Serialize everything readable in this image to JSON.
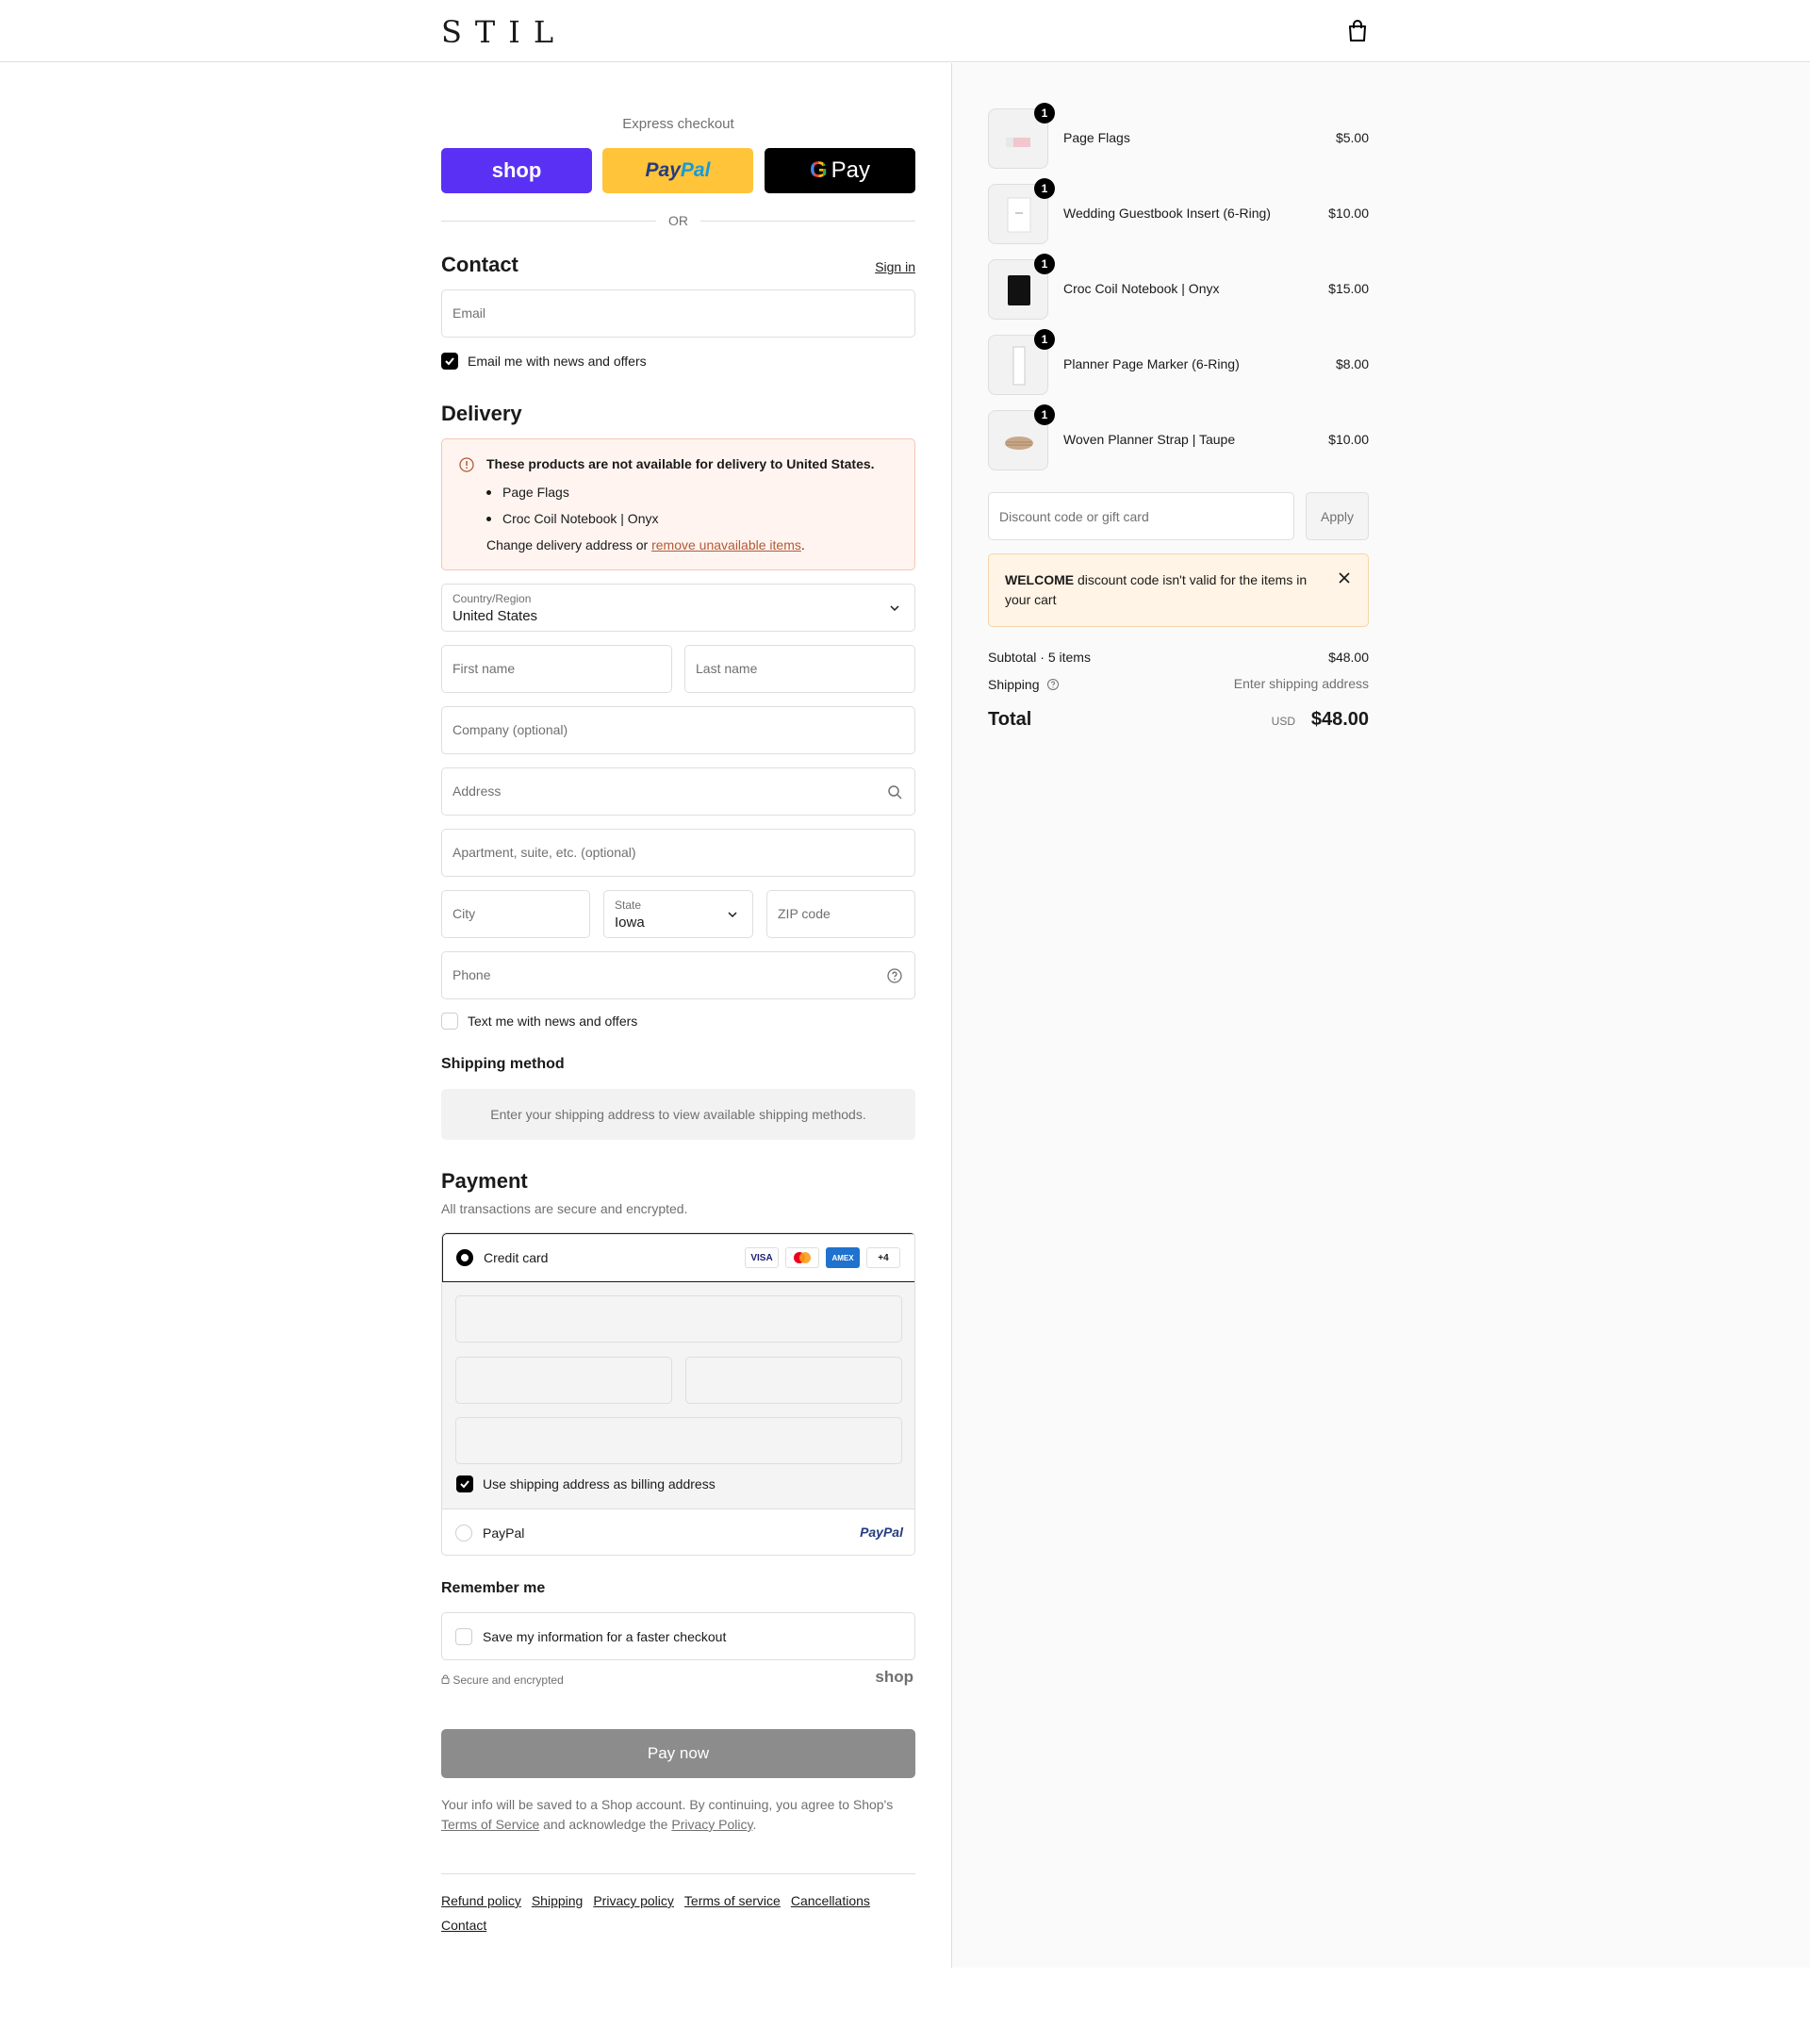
{
  "header": {
    "logo": "STIL",
    "cart_icon": "bag-icon"
  },
  "express": {
    "label": "Express checkout",
    "shop": "shop",
    "paypal_a": "Pay",
    "paypal_b": "Pal",
    "gpay_g": "G",
    "gpay": "Pay",
    "or": "OR"
  },
  "contact": {
    "title": "Contact",
    "sign_in": "Sign in",
    "email_placeholder": "Email",
    "news_label": "Email me with news and offers",
    "news_checked": true
  },
  "delivery": {
    "title": "Delivery",
    "warning_title": "These products are not available for delivery to United States.",
    "warning_items": [
      "Page Flags",
      "Croc Coil Notebook | Onyx"
    ],
    "warning_foot_pre": "Change delivery address or ",
    "warning_link": "remove unavailable items",
    "warning_foot_post": ".",
    "country_label": "Country/Region",
    "country_value": "United States",
    "first_name": "First name",
    "last_name": "Last name",
    "company": "Company (optional)",
    "address": "Address",
    "apartment": "Apartment, suite, etc. (optional)",
    "city": "City",
    "state_label": "State",
    "state_value": "Iowa",
    "zip": "ZIP code",
    "phone": "Phone",
    "text_label": "Text me with news and offers",
    "text_checked": false
  },
  "shipping_method": {
    "title": "Shipping method",
    "message": "Enter your shipping address to view available shipping methods."
  },
  "payment": {
    "title": "Payment",
    "subtitle": "All transactions are secure and encrypted.",
    "credit_card": "Credit card",
    "cards": [
      "VISA",
      "MC",
      "AMEX",
      "+4"
    ],
    "billing_label": "Use shipping address as billing address",
    "paypal": "PayPal",
    "paypal_logo": "PayPal"
  },
  "remember": {
    "title": "Remember me",
    "save_label": "Save my information for a faster checkout",
    "secure": "Secure and encrypted",
    "shop_logo": "shop"
  },
  "pay_now": "Pay now",
  "legal": {
    "pre": "Your info will be saved to a Shop account. By continuing, you agree to Shop's ",
    "tos": "Terms of Service",
    "mid": " and acknowledge the ",
    "privacy": "Privacy Policy",
    "post": "."
  },
  "footer_links": [
    "Refund policy",
    "Shipping",
    "Privacy policy",
    "Terms of service",
    "Cancellations",
    "Contact"
  ],
  "cart": {
    "items": [
      {
        "name": "Page Flags",
        "qty": "1",
        "price": "$5.00"
      },
      {
        "name": "Wedding Guestbook Insert (6-Ring)",
        "qty": "1",
        "price": "$10.00"
      },
      {
        "name": "Croc Coil Notebook | Onyx",
        "qty": "1",
        "price": "$15.00"
      },
      {
        "name": "Planner Page Marker (6-Ring)",
        "qty": "1",
        "price": "$8.00"
      },
      {
        "name": "Woven Planner Strap | Taupe",
        "qty": "1",
        "price": "$10.00"
      }
    ],
    "discount_placeholder": "Discount code or gift card",
    "apply": "Apply",
    "discount_code": "WELCOME",
    "discount_msg": " discount code isn't valid for the items in your cart",
    "subtotal_label": "Subtotal · 5 items",
    "subtotal": "$48.00",
    "shipping_label": "Shipping",
    "shipping_value": "Enter shipping address",
    "total_label": "Total",
    "currency": "USD",
    "total": "$48.00"
  }
}
